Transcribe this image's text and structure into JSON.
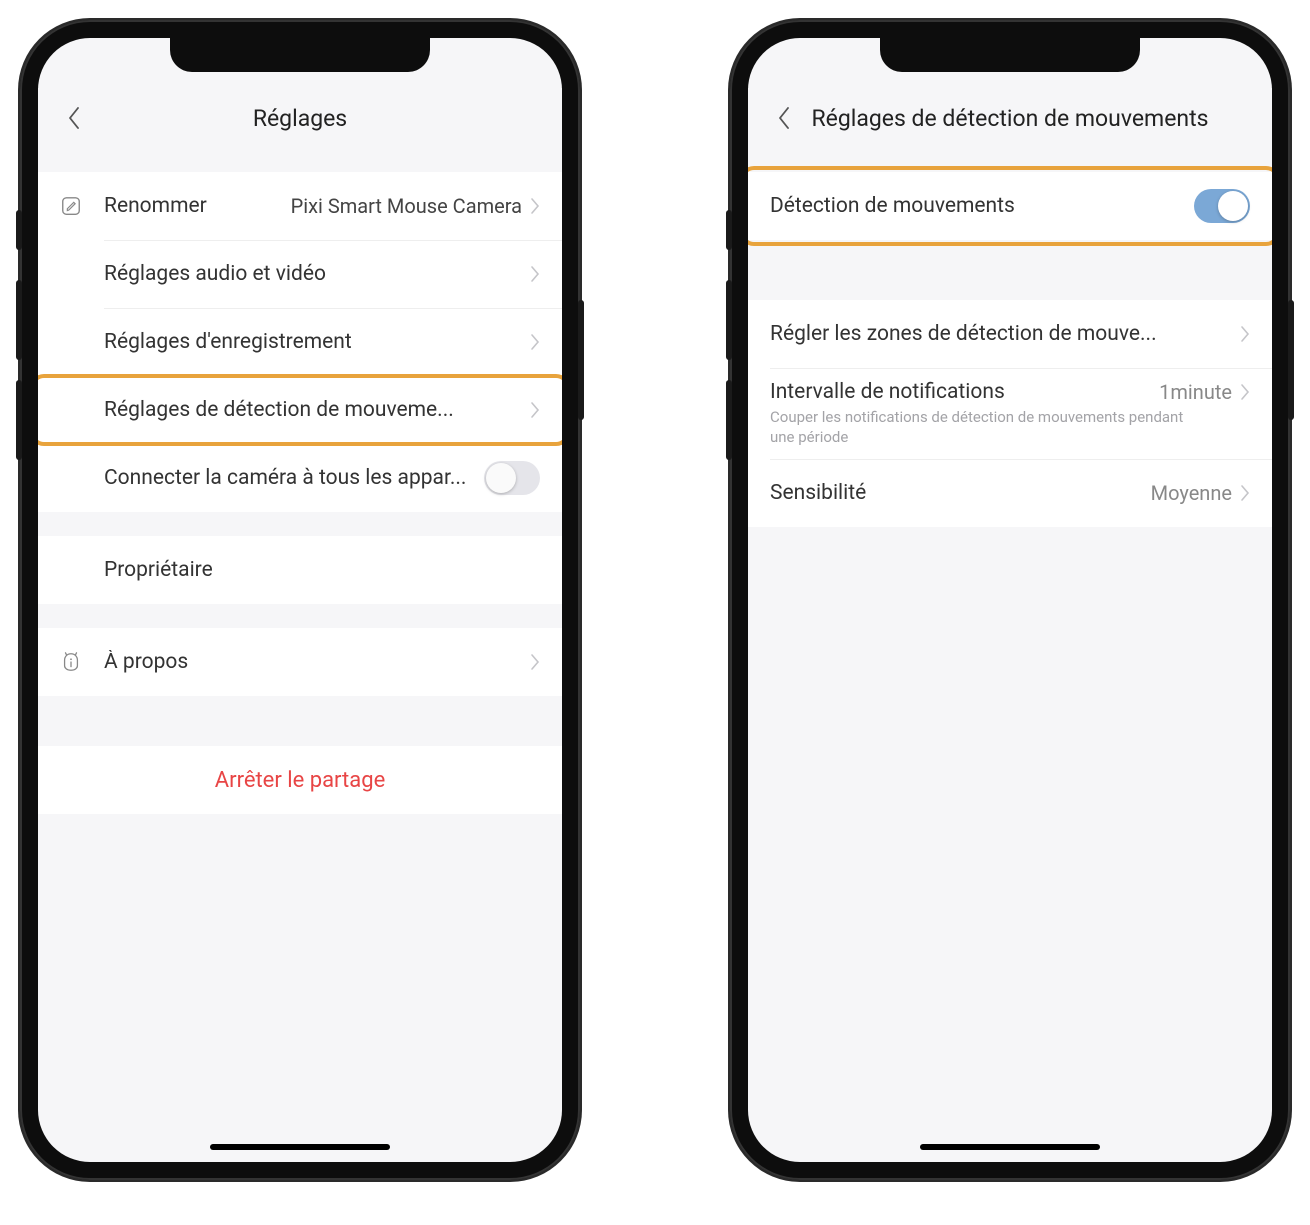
{
  "left": {
    "header_title": "Réglages",
    "rows": {
      "rename_label": "Renommer",
      "rename_value": "Pixi Smart Mouse Camera",
      "av_label": "Réglages audio et vidéo",
      "record_label": "Réglages d'enregistrement",
      "motion_label": "Réglages de détection de mouveme...",
      "connect_label": "Connecter la caméra à tous les appar...",
      "owner_label": "Propriétaire",
      "about_label": "À propos",
      "stop_share": "Arrêter le partage"
    }
  },
  "right": {
    "header_title": "Réglages de détection de mouvements",
    "rows": {
      "motion_detect_label": "Détection de mouvements",
      "zones_label": "Régler les zones de détection de mouve...",
      "interval_label": "Intervalle de notifications",
      "interval_sub": "Couper les notifications de détection de mouvements pendant une période",
      "interval_value": "1minute",
      "sensitivity_label": "Sensibilité",
      "sensitivity_value": "Moyenne"
    }
  }
}
